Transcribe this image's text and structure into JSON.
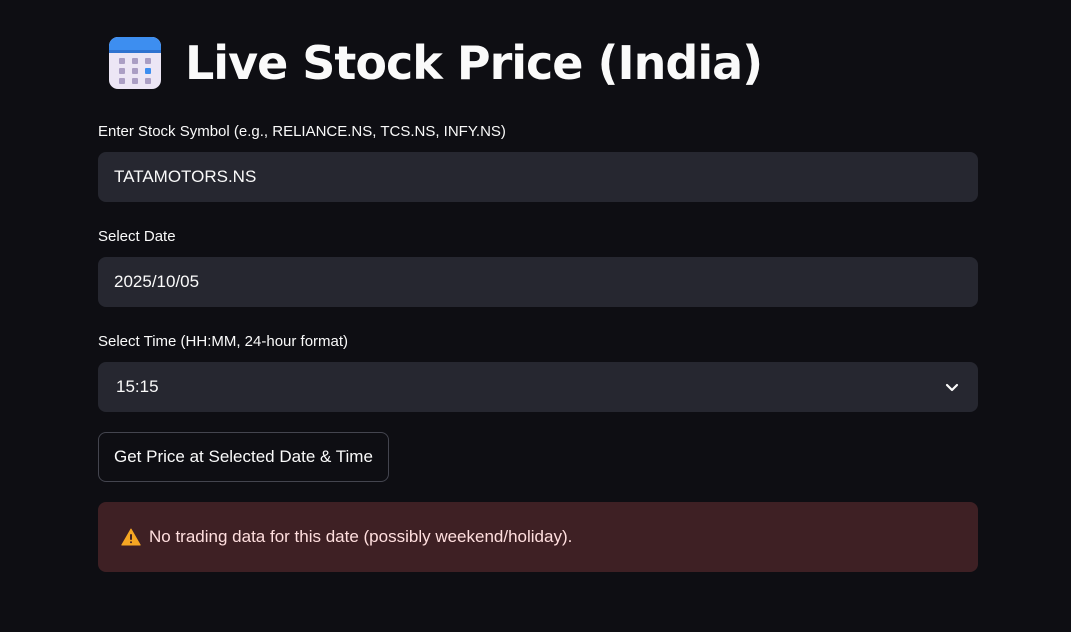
{
  "header": {
    "title": "Live Stock Price (India)",
    "icon": "calendar-icon"
  },
  "symbol_field": {
    "label": "Enter Stock Symbol (e.g., RELIANCE.NS, TCS.NS, INFY.NS)",
    "value": "TATAMOTORS.NS"
  },
  "date_field": {
    "label": "Select Date",
    "value": "2025/10/05"
  },
  "time_field": {
    "label": "Select Time (HH:MM, 24-hour format)",
    "selected": "15:15",
    "icon": "chevron-down-icon"
  },
  "action": {
    "label": "Get Price at Selected Date & Time"
  },
  "alert": {
    "icon": "warning-icon",
    "message": "No trading data for this date (possibly weekend/holiday)."
  },
  "colors": {
    "background": "#0e0e13",
    "input_bg": "#262730",
    "alert_bg": "#3e2024",
    "alert_text": "#ffdede",
    "warning": "#f5a623"
  }
}
